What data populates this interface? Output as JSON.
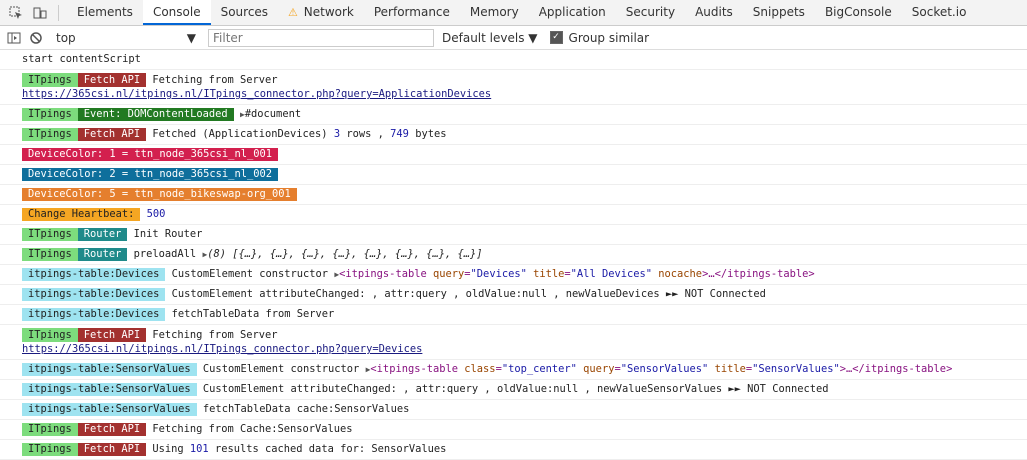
{
  "tabs": [
    "Elements",
    "Console",
    "Sources",
    "Network",
    "Performance",
    "Memory",
    "Application",
    "Security",
    "Audits",
    "Snippets",
    "BigConsole",
    "Socket.io"
  ],
  "toolbar": {
    "context": "top",
    "filter_placeholder": "Filter",
    "levels": "Default levels",
    "group_similar": "Group similar"
  },
  "log": {
    "r1": "start contentScript",
    "itpings": "ITpings",
    "fetchapi": "Fetch API",
    "r2_text": "Fetching from  Server",
    "r2_link": "https://365csi.nl/itpings.nl/ITpings_connector.php?query=ApplicationDevices",
    "event": "Event: DOMContentLoaded",
    "r3_node": "#document",
    "r4_a": "Fetched (ApplicationDevices)",
    "r4_n1": "3",
    "r4_b": "rows ,",
    "r4_n2": "749",
    "r4_c": "bytes",
    "dc1": "DeviceColor: 1 = ttn_node_365csi_nl_001",
    "dc2": "DeviceColor: 2 = ttn_node_365csi_nl_002",
    "dc5": "DeviceColor: 5 = ttn_node_bikeswap-org_001",
    "hb": "Change Heartbeat:",
    "hb_val": "500",
    "router": "Router",
    "init": "Init Router",
    "preload": "preloadAll",
    "preload_arr": "(8) [{…}, {…}, {…}, {…}, {…}, {…}, {…}, {…}]",
    "devices_tag": "itpings-table:Devices",
    "ctor": "CustomElement constructor",
    "el1_open": "<itpings-table",
    "el1_attrs": [
      [
        "query",
        "\"Devices\""
      ],
      [
        "title",
        "\"All Devices\""
      ],
      [
        "nocache",
        ""
      ]
    ],
    "el_close": ">…</itpings-table>",
    "attr_dev": "CustomElement attributeChanged: , attr:query , oldValue:null , newValueDevices ►► NOT Connected",
    "ftd_dev": "fetchTableData from Server",
    "r_link2": "https://365csi.nl/itpings.nl/ITpings_connector.php?query=Devices",
    "sensor_tag": "itpings-table:SensorValues",
    "el2_attrs": [
      [
        "class",
        "\"top_center\""
      ],
      [
        "query",
        "\"SensorValues\""
      ],
      [
        "title",
        "\"SensorValues\""
      ]
    ],
    "attr_sen": "CustomElement attributeChanged: , attr:query , oldValue:null , newValueSensorValues ►► NOT Connected",
    "ftd_sen": "fetchTableData cache:SensorValues",
    "fetch_cache": "Fetching from  Cache:SensorValues",
    "using": "Using",
    "using_n": "101",
    "using_rest": "results cached data for: SensorValues"
  }
}
